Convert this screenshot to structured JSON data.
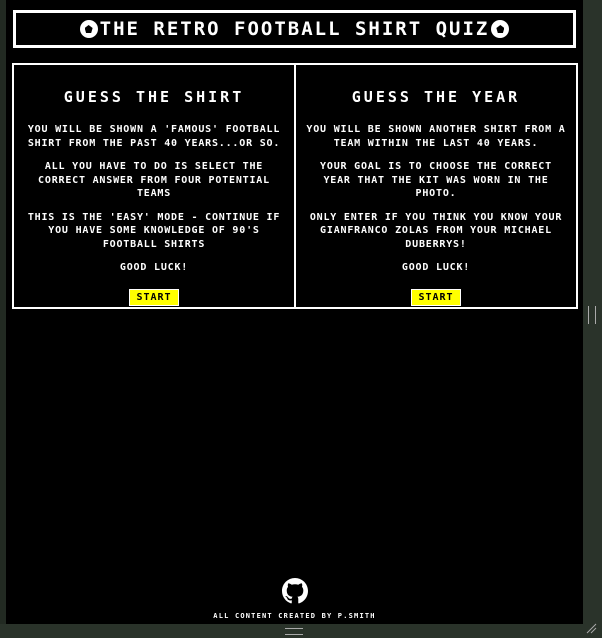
{
  "header": {
    "title": "The Retro Football Shirt Quiz",
    "icon": "football-icon"
  },
  "cards": [
    {
      "heading": "Guess the Shirt",
      "paragraphs": [
        "You will be shown a 'famous' football shirt from the past 40 years...or so.",
        "All you have to do is select the correct answer from four potential teams",
        "This is the 'easy' mode - continue if you have some knowledge of 90's football shirts"
      ],
      "luck": "Good Luck!",
      "button": "Start"
    },
    {
      "heading": "Guess the Year",
      "paragraphs": [
        "You will be shown another shirt from a team within the last 40 years.",
        "Your goal is to choose the correct year that the kit was worn in the photo.",
        "Only enter if you think you know your Gianfranco Zolas from your Michael Duberrys!"
      ],
      "luck": "Good Luck!",
      "button": "Start"
    }
  ],
  "footer": {
    "icon": "github-icon",
    "text": "All content created by P.Smith"
  },
  "colors": {
    "background": "#000000",
    "text": "#ffffff",
    "button": "#ffff00"
  }
}
